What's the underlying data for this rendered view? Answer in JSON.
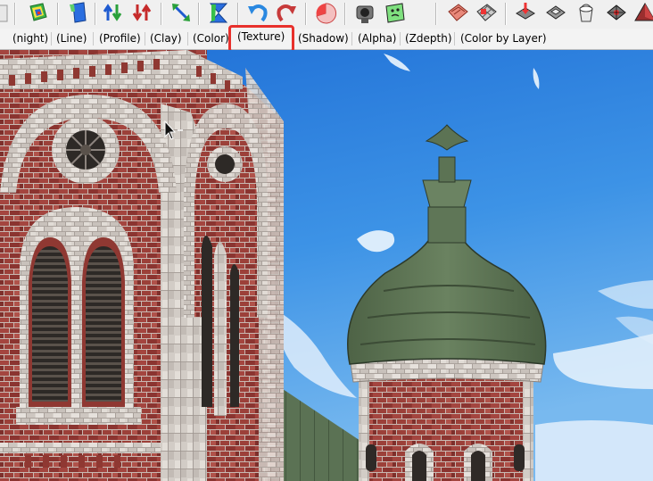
{
  "toolbar": {
    "icons": [
      "partial-icon",
      "layer-cube-icon",
      "bookmark-icon",
      "move-up-down-icon",
      "move-down-icon",
      "resize-diagonal-icon",
      "hourglass-icon",
      "rotate-left-icon",
      "rotate-right-icon",
      "pie-slice-icon",
      "camera-figure-icon",
      "face-map-icon",
      "terrain-icon",
      "grid-select-icon",
      "cube-drop-icon",
      "ground-view-icon",
      "bucket-icon",
      "compass-icon",
      "pyramid-icon"
    ]
  },
  "render_modes": {
    "active": "(Texture)",
    "tabs": [
      {
        "label": "(night)"
      },
      {
        "label": "(Line)"
      },
      {
        "label": "(Profile)"
      },
      {
        "label": "(Clay)"
      },
      {
        "label": "(Color)"
      },
      {
        "label": "(Texture)"
      },
      {
        "label": "(Shadow)"
      },
      {
        "label": "(Alpha)"
      },
      {
        "label": "(Zdepth)"
      },
      {
        "label": "(Color by Layer)"
      }
    ]
  },
  "colors": {
    "sky_top": "#1d6fd8",
    "sky_bottom": "#5aa7ea",
    "brick": "#9a3b36",
    "stone": "#d9d4cf",
    "roof_green": "#5c7454",
    "highlight": "#e8312c"
  }
}
